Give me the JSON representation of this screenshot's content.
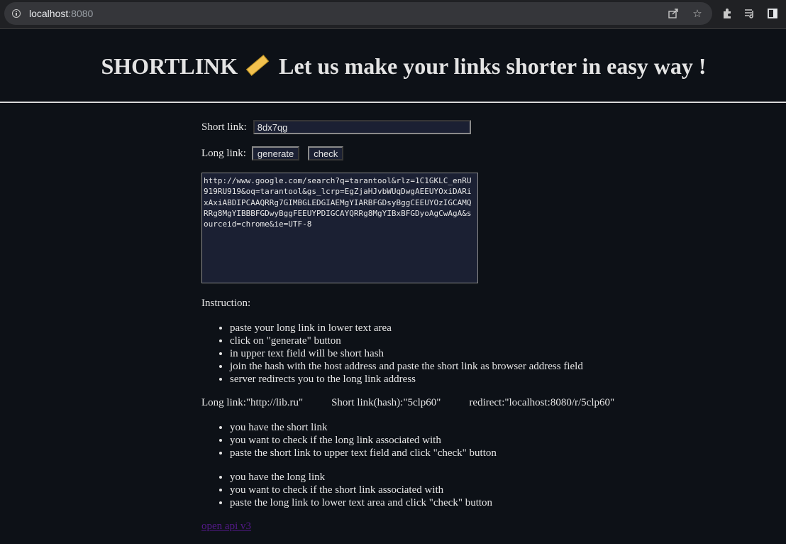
{
  "browser": {
    "url_host": "localhost",
    "url_port": ":8080"
  },
  "header": {
    "brand": "SHORTLINK",
    "tagline": "Let us make your links shorter in easy way !"
  },
  "form": {
    "short_label": "Short link:",
    "short_value": "8dx7qg",
    "long_label": "Long link:",
    "generate_label": "generate",
    "check_label": "check",
    "long_value": "http://www.google.com/search?q=tarantool&rlz=1C1GKLC_enRU919RU919&oq=tarantool&gs_lcrp=EgZjaHJvbWUqDwgAEEUYOxiDARixAxiABDIPCAAQRRg7GIMBGLEDGIAEMgYIARBFGDsyBggCEEUYOzIGCAMQRRg8MgYIBBBFGDwyBggFEEUYPDIGCAYQRRg8MgYIBxBFGDyoAgCwAgA&sourceid=chrome&ie=UTF-8"
  },
  "instruction": {
    "title": "Instruction:",
    "steps": [
      "paste your long link in lower text area",
      "click on \"generate\" button",
      "in upper text field will be short hash",
      "join the hash with the host address and paste the short link as browser address field",
      "server redirects you to the long link address"
    ],
    "example_long": "Long link:\"http://lib.ru\"",
    "example_short": "Short link(hash):\"5clp60\"",
    "example_redirect": "redirect:\"localhost:8080/r/5clp60\"",
    "check_short_steps": [
      "you have the short link",
      "you want to check if the long link associated with",
      "paste the short link to upper text field and click \"check\" button"
    ],
    "check_long_steps": [
      "you have the long link",
      "you want to check if the short link associated with",
      "paste the long link to lower text area and click \"check\" button"
    ]
  },
  "footer": {
    "api_link": "open api v3"
  },
  "colors": {
    "page_bg": "#0d1117",
    "field_bg": "#1b2033",
    "text": "#e6e6e6",
    "link": "#551a8b"
  }
}
